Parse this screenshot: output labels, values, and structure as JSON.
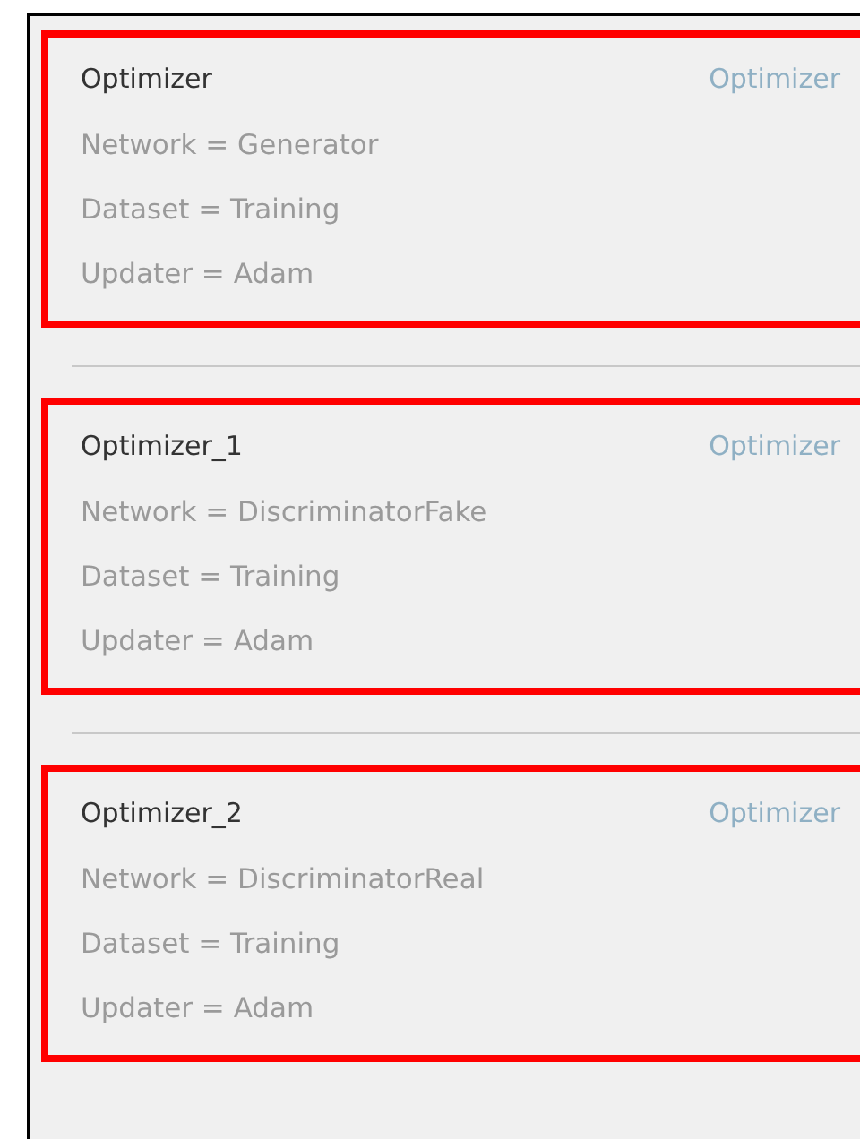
{
  "optimizers": [
    {
      "name": "Optimizer",
      "type": "Optimizer",
      "highlighted": true,
      "properties": [
        "Network = Generator",
        "Dataset = Training",
        "Updater = Adam"
      ]
    },
    {
      "name": "Optimizer_1",
      "type": "Optimizer",
      "highlighted": true,
      "properties": [
        "Network = DiscriminatorFake",
        "Dataset = Training",
        "Updater = Adam"
      ]
    },
    {
      "name": "Optimizer_2",
      "type": "Optimizer",
      "highlighted": true,
      "properties": [
        "Network = DiscriminatorReal",
        "Dataset = Training",
        "Updater = Adam"
      ]
    }
  ]
}
